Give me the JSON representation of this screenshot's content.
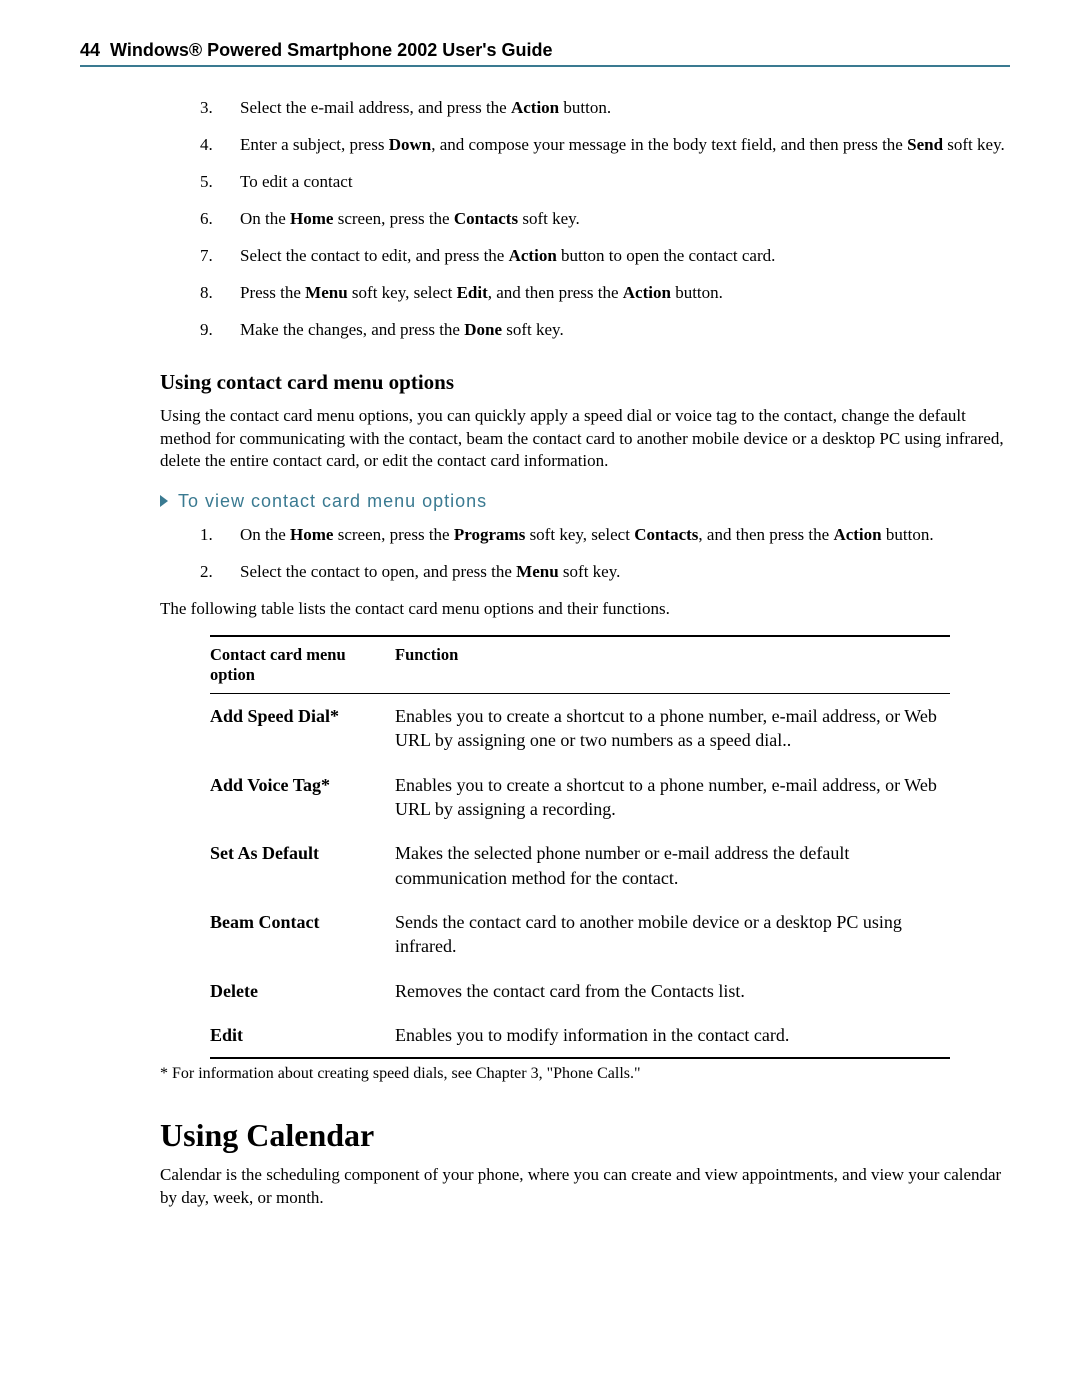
{
  "header": {
    "page_number": "44",
    "title": "Windows® Powered Smartphone 2002 User's Guide"
  },
  "steps_a": {
    "s3": "Select the e-mail address, and press the <b>Action</b> button.",
    "s4": "Enter a subject, press <b>Down</b>, and compose your message in the body text field, and then press the <b>Send</b> soft key.",
    "s5": "To edit a contact",
    "s6": "On the <b>Home</b> screen, press the <b>Contacts</b> soft key.",
    "s7": "Select the contact to edit, and press the <b>Action</b> button to open the contact card.",
    "s8": "Press the <b>Menu</b> soft key, select <b>Edit</b>, and then press the <b>Action</b> button.",
    "s9": "Make the changes, and press the <b>Done</b> soft key."
  },
  "subhead1": "Using contact card menu options",
  "para1": "Using the contact card menu options, you can quickly apply a speed dial or voice tag to the contact, change the default method for communicating with the contact, beam the contact card to another mobile device or a desktop PC using infrared, delete the entire contact card, or edit the contact card information.",
  "proc_head": "To view contact card menu options",
  "steps_b": {
    "s1": "On the <b>Home</b> screen, press the <b>Programs</b> soft key, select <b>Contacts</b>, and then press the <b>Action</b> button.",
    "s2": "Select the contact to open, and press the <b>Menu</b> soft key."
  },
  "table_intro": "The following table lists the contact card menu options and their functions.",
  "table": {
    "head_option": "Contact card menu option",
    "head_function": "Function",
    "rows": [
      {
        "option": "Add Speed Dial*",
        "func": "Enables you to create a shortcut to a phone number, e-mail address, or Web URL by assigning one or two numbers as a speed dial.."
      },
      {
        "option": "Add Voice Tag*",
        "func": "Enables you to create a shortcut to a phone number, e-mail address, or Web URL by assigning a recording."
      },
      {
        "option": "Set As Default",
        "func": "Makes the selected phone number or e-mail address the default communication method for the contact."
      },
      {
        "option": "Beam Contact",
        "func": "Sends the contact card to another mobile device or a desktop PC using infrared."
      },
      {
        "option": "Delete",
        "func": "Removes the contact card from the Contacts list."
      },
      {
        "option": "Edit",
        "func": "Enables you to modify information in the contact card."
      }
    ]
  },
  "footnote": "* For information about creating speed dials, see Chapter 3, \"Phone Calls.\"",
  "section_title": "Using Calendar",
  "para2": "Calendar is the scheduling component of your phone, where you can create and view appointments, and view your calendar by day, week, or month."
}
